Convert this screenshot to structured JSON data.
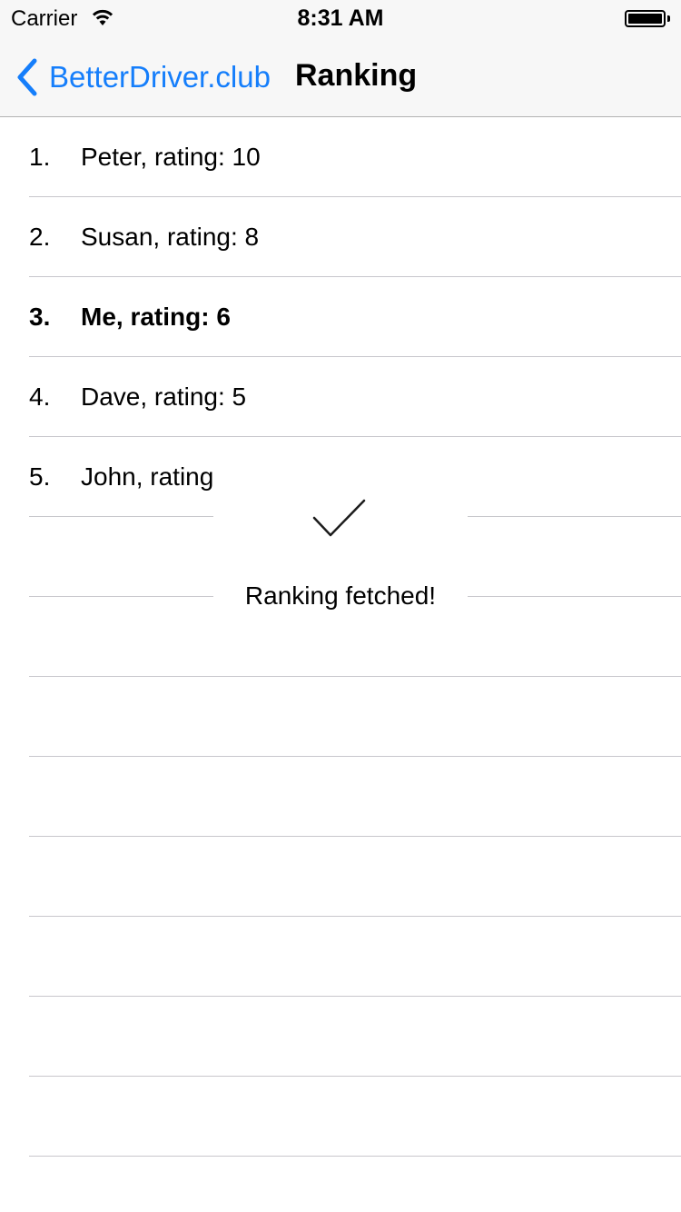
{
  "status_bar": {
    "carrier": "Carrier",
    "time": "8:31 AM",
    "wifi_icon": "wifi-icon",
    "battery_icon": "battery-icon"
  },
  "nav": {
    "back_label": "BetterDriver.club",
    "back_icon": "chevron-left-icon",
    "title": "Ranking",
    "accent_color": "#157efb"
  },
  "ranking": [
    {
      "position": "1.",
      "label": "Peter, rating: 10",
      "highlighted": false
    },
    {
      "position": "2.",
      "label": "Susan, rating: 8",
      "highlighted": false
    },
    {
      "position": "3.",
      "label": "Me, rating: 6",
      "highlighted": true
    },
    {
      "position": "4.",
      "label": "Dave, rating: 5",
      "highlighted": false
    },
    {
      "position": "5.",
      "label": "John, rating",
      "highlighted": false
    }
  ],
  "hud": {
    "icon": "checkmark-icon",
    "message": "Ranking fetched!"
  }
}
